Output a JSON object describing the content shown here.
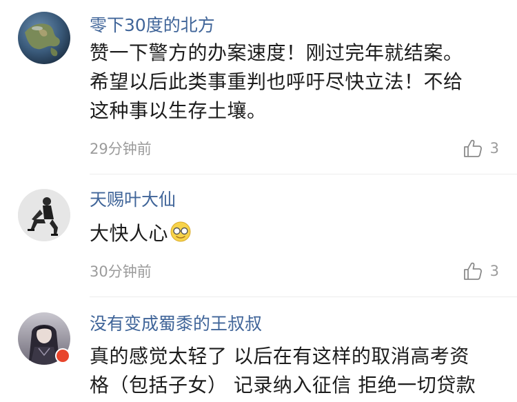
{
  "comments": [
    {
      "username": "零下30度的北方",
      "lines": [
        "赞一下警方的办案速度！刚过完年就结案。",
        "希望以后此类事重判也呼吁尽快立法！不给",
        "这种事以生存土壤。"
      ],
      "time": "29分钟前",
      "likes": "3",
      "avatar_icon": "earth-globe-avatar"
    },
    {
      "username": "天赐叶大仙",
      "lines": [
        "大快人心"
      ],
      "emoji": "grinning-face-emoji",
      "time": "30分钟前",
      "likes": "3",
      "avatar_icon": "seated-person-avatar"
    },
    {
      "username": "没有变成蜀黍的王叔叔",
      "lines": [
        "真的感觉太轻了 以后在有这样的取消高考资",
        "格（包括子女） 记录纳入征信 拒绝一切贷款"
      ],
      "avatar_icon": "anime-character-avatar",
      "badge_icon": "verified-badge-icon"
    }
  ],
  "colors": {
    "username": "#406599",
    "meta": "#9b9b9b",
    "text": "#1c1c1c",
    "badge": "#e8452c"
  }
}
